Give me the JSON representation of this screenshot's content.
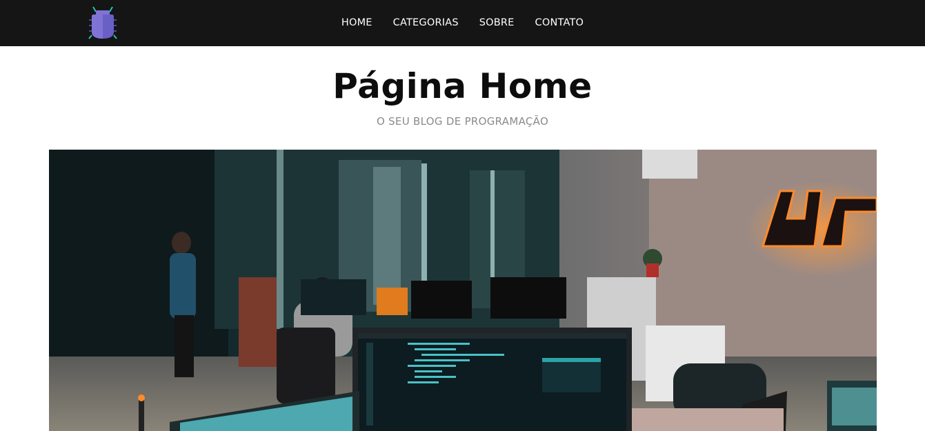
{
  "nav": {
    "logo_icon": "bug-icon",
    "links": [
      {
        "label": "HOME"
      },
      {
        "label": "CATEGORIAS"
      },
      {
        "label": "SOBRE"
      },
      {
        "label": "CONTATO"
      }
    ]
  },
  "hero": {
    "title": "Página Home",
    "subtitle": "O SEU BLOG DE PROGRAMAÇÃO",
    "image_icon": "office-photo"
  },
  "colors": {
    "topbar": "#151515",
    "logo_purple": "#6a5fc4",
    "logo_teal": "#1ec7b6",
    "title": "#0d0d0d",
    "subtitle": "#8a8a8a",
    "neon_orange": "#ff8a2b"
  }
}
